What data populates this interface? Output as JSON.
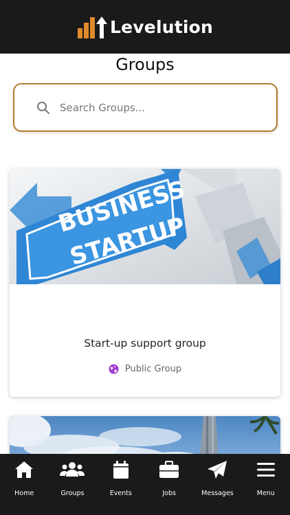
{
  "header": {
    "logo_text": "Levelution",
    "logo_icon": "bar-chart-arrow-icon",
    "accent_color": "#e08a2c"
  },
  "page": {
    "title": "Groups"
  },
  "search": {
    "placeholder": "Search Groups...",
    "value": "",
    "icon": "search-icon",
    "border_color": "#b27a2e"
  },
  "groups": [
    {
      "name": "Start-up support group",
      "type": "Public Group",
      "type_icon": "globe-icon",
      "type_icon_color": "#a23bd1",
      "image": {
        "caption_line1": "BUSINESS",
        "caption_line2": "STARTUP"
      }
    },
    {
      "name": "",
      "type": "",
      "image": {
        "description": "sky-and-tower"
      }
    }
  ],
  "tabbar": {
    "items": [
      {
        "label": "Home",
        "icon": "home-icon"
      },
      {
        "label": "Groups",
        "icon": "users-icon"
      },
      {
        "label": "Events",
        "icon": "calendar-icon"
      },
      {
        "label": "Jobs",
        "icon": "briefcase-icon"
      },
      {
        "label": "Messages",
        "icon": "paper-plane-icon"
      },
      {
        "label": "Menu",
        "icon": "menu-icon"
      }
    ]
  }
}
